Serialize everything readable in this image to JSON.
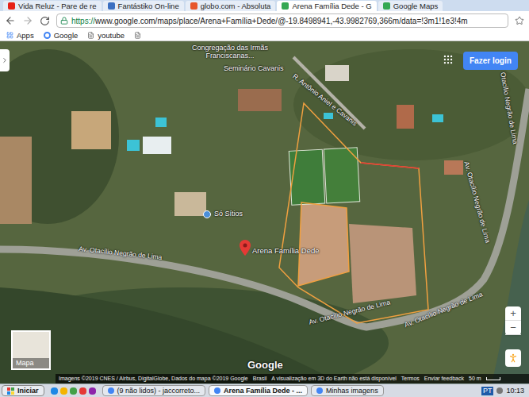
{
  "browser": {
    "tabs": [
      {
        "label": "Vida Reluz - Pare de re",
        "selected": false
      },
      {
        "label": "Fantástiko On-line",
        "selected": false
      },
      {
        "label": "globo.com - Absoluta",
        "selected": false
      },
      {
        "label": "Arena Família Dede - G",
        "selected": true
      },
      {
        "label": "Google Maps",
        "selected": false
      }
    ],
    "address": {
      "secure_prefix": "https://",
      "rest": "www.google.com/maps/place/Arena+Família+Dede/@-19.8498941,-43.9982769,366m/data=!3m1!1e3!4m"
    },
    "bookmarks": [
      "Apps",
      "Google",
      "youtube"
    ]
  },
  "map": {
    "login_button": "Fazer login",
    "labels": [
      {
        "text": "Congregação das Irmãs Franciscanas...",
        "kind": "place"
      },
      {
        "text": "Seminário Cavanis",
        "kind": "place"
      },
      {
        "text": "R. Antônio Aniel e Cavanis",
        "kind": "road"
      },
      {
        "text": "Só Sítios",
        "kind": "business"
      },
      {
        "text": "Av. Otacílio Negrão de Lima",
        "kind": "road"
      },
      {
        "text": "Av. Otacílio Negrão de Lima",
        "kind": "road"
      },
      {
        "text": "Av. Otacílio Negrão de Lima",
        "kind": "road"
      },
      {
        "text": "Av. Otacílio Negrão de Lima",
        "kind": "road"
      },
      {
        "text": "Otacílio Negrão de Lima",
        "kind": "road"
      }
    ],
    "pin": {
      "label": "Arena Família Dede"
    },
    "thumbnail": "Mapa",
    "zoom": [
      "+",
      "−"
    ],
    "logo": "Google",
    "attribution": [
      "Imagens ©2019 CNES / Airbus, DigitalGlobe, Dados do mapa ©2019 Google",
      "Brasil",
      "A visualização em 3D do Earth não está disponível",
      "Termos",
      "Enviar feedback"
    ],
    "scale": "50 m"
  },
  "taskbar": {
    "start": "Iniciar",
    "tasks": [
      {
        "label": "(9 não lidos) - jaccorreto...",
        "selected": false
      },
      {
        "label": "Arena Família Dede - ...",
        "selected": true
      },
      {
        "label": "Minhas imagens",
        "selected": false
      }
    ],
    "language": "PT",
    "clock": "10:13"
  }
}
